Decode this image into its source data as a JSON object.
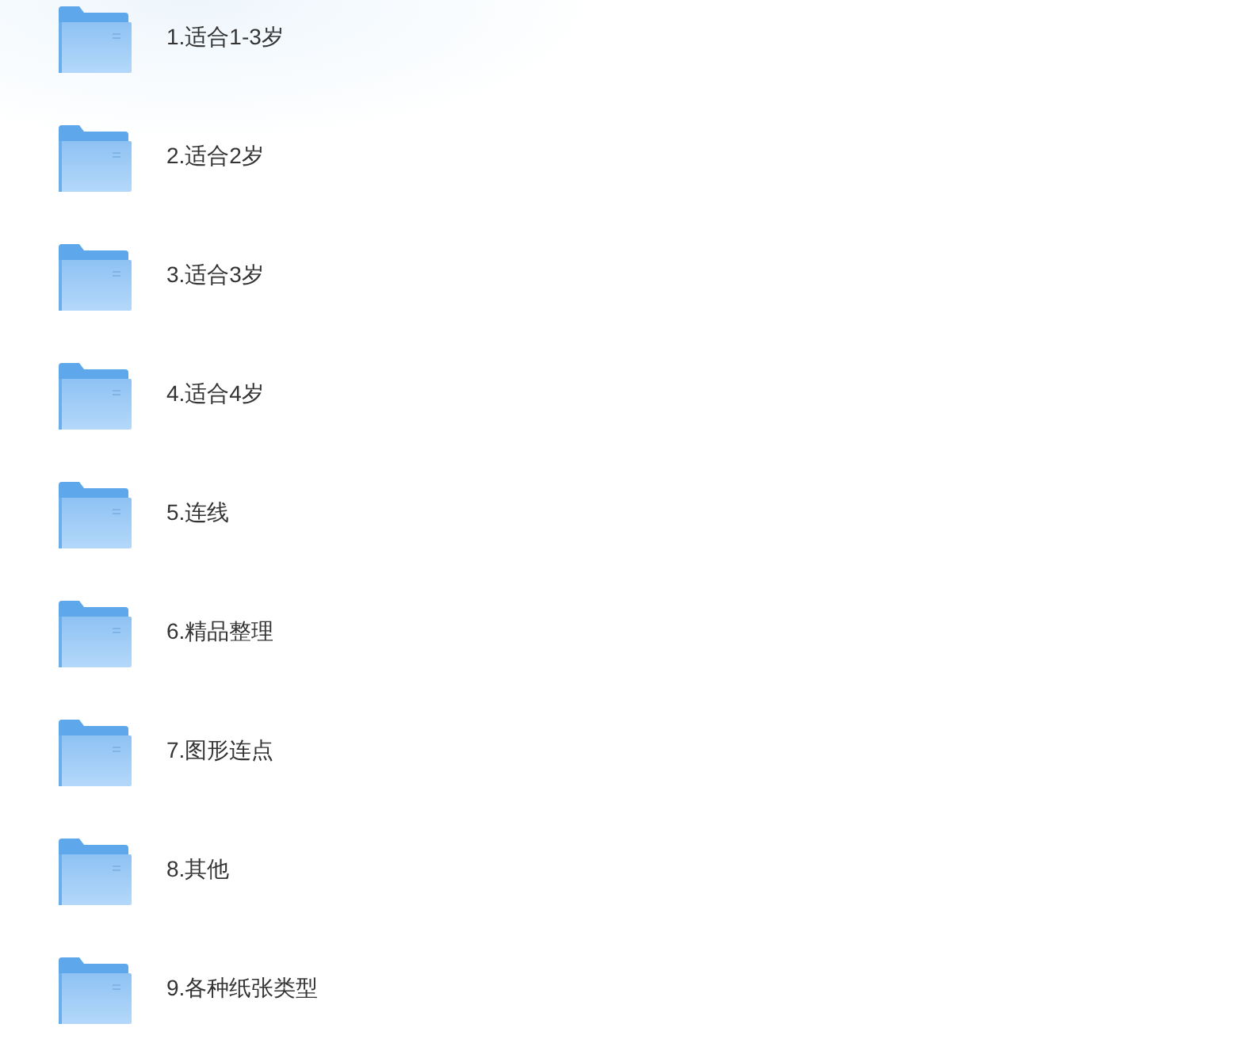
{
  "folders": [
    {
      "name": "1.适合1-3岁"
    },
    {
      "name": "2.适合2岁"
    },
    {
      "name": "3.适合3岁"
    },
    {
      "name": "4.适合4岁"
    },
    {
      "name": "5.连线"
    },
    {
      "name": "6.精品整理"
    },
    {
      "name": "7.图形连点"
    },
    {
      "name": "8.其他"
    },
    {
      "name": "9.各种纸张类型"
    }
  ]
}
